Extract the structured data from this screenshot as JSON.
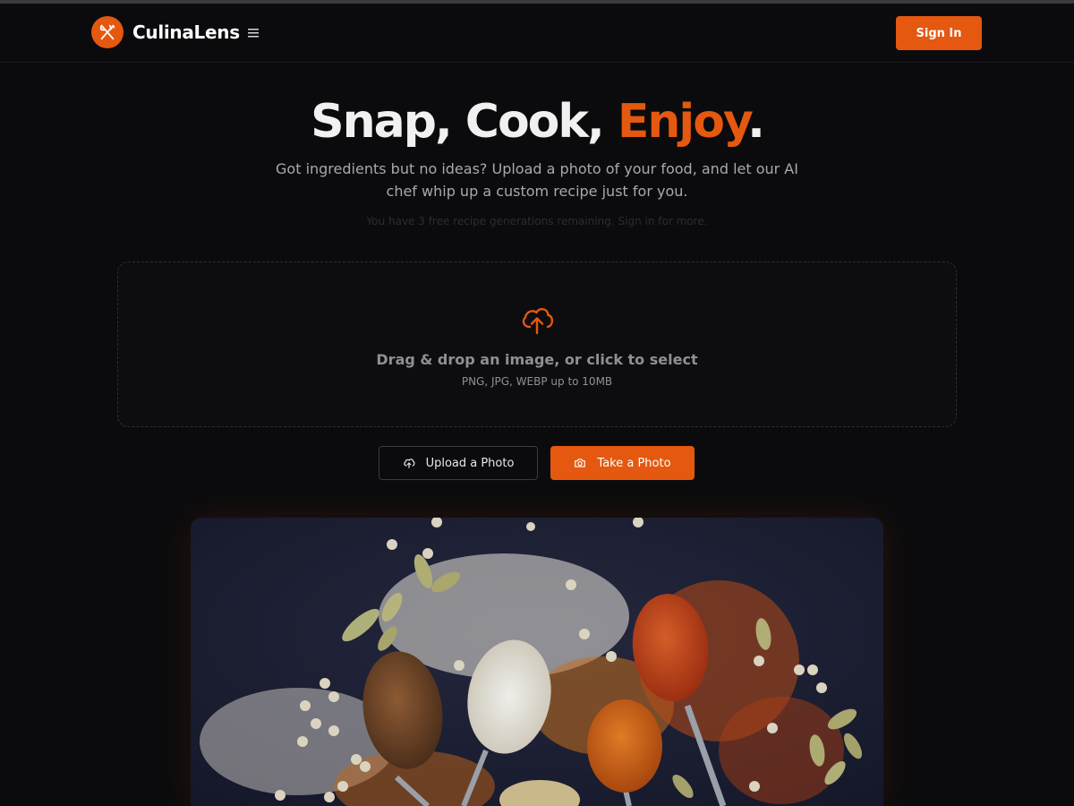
{
  "app": {
    "name": "CulinaLens"
  },
  "header": {
    "sign_in_label": "Sign In"
  },
  "hero": {
    "title_part1": "Snap, Cook, ",
    "title_accent": "Enjoy",
    "title_end": ".",
    "subtitle": "Got ingredients but no ideas? Upload a photo of your food, and let our AI chef whip up a custom recipe just for you.",
    "quota_note": "You have 3 free recipe generations remaining. Sign in for more."
  },
  "dropzone": {
    "title": "Drag & drop an image, or click to select",
    "hint": "PNG, JPG, WEBP up to 10MB"
  },
  "actions": {
    "upload_label": "Upload a Photo",
    "camera_label": "Take a Photo"
  },
  "colors": {
    "accent": "#e4580f",
    "background": "#0b0b0d",
    "muted_text": "#8f8f96"
  },
  "icons": {
    "logo": "utensils-icon",
    "menu": "hamburger-menu-icon",
    "dropzone": "cloud-upload-icon",
    "upload_button": "cloud-upload-icon",
    "camera_button": "camera-icon"
  }
}
